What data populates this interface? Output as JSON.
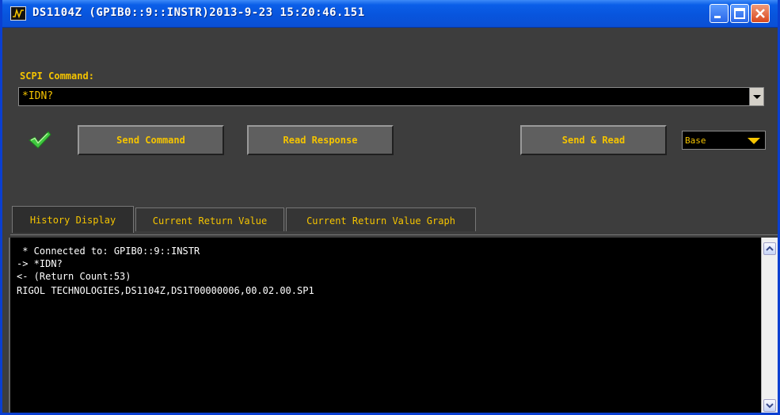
{
  "window": {
    "title": "DS1104Z (GPIB0::9::INSTR)2013-9-23 15:20:46.151",
    "controls": [
      "minimize",
      "maximize",
      "close"
    ]
  },
  "scpi": {
    "label": "SCPI Command:",
    "value": "*IDN?"
  },
  "status": {
    "icon": "green-checkmark"
  },
  "buttons": {
    "send_command": "Send Command",
    "read_response": "Read Response",
    "send_read": "Send & Read"
  },
  "mode_select": {
    "value": "Base"
  },
  "tabs": [
    {
      "label": "History Display",
      "active": true
    },
    {
      "label": "Current Return Value",
      "active": false
    },
    {
      "label": "Current Return Value Graph",
      "active": false
    }
  ],
  "history": [
    " * Connected to: GPIB0::9::INSTR",
    "-> *IDN?",
    "<- (Return Count:53)",
    "RIGOL TECHNOLOGIES,DS1104Z,DS1T00000006,00.02.00.SP1"
  ],
  "colors": {
    "accent": "#f5c400",
    "titlebar": "#0a5ee8",
    "panel": "#3d3d3d",
    "console_bg": "#000000"
  }
}
